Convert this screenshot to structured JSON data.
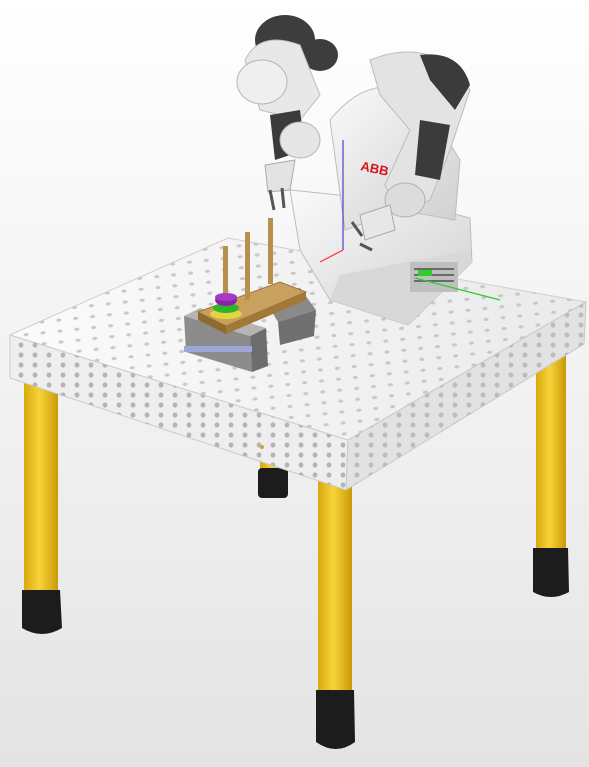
{
  "scene": {
    "robot_logo_text": "ABB"
  },
  "colors": {
    "background": "#efefef",
    "table_top": "#f4f4f4",
    "table_hole": "#c9c9c9",
    "leg_yellow": "#f2c21b",
    "leg_foot": "#1c1c1c",
    "robot_white": "#e3e3e3",
    "robot_dark": "#3b3b3b",
    "logo_red": "#d4161c",
    "wood": "#b98f4e",
    "ring_purple": "#8b21a8",
    "ring_green": "#2fb32f",
    "ring_yellow": "#e1d63c",
    "axis_blue": "#3d3dff",
    "axis_green": "#2ecc2e",
    "axis_red": "#ff3030"
  }
}
